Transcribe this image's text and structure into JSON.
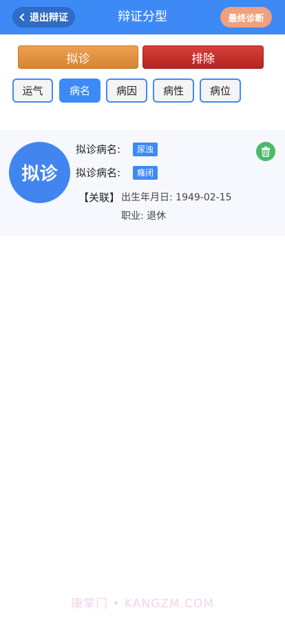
{
  "header": {
    "back_label": "退出辩证",
    "title": "辩证分型",
    "final_label": "最终诊断"
  },
  "actions": {
    "diagnose_label": "拟诊",
    "exclude_label": "排除"
  },
  "tabs": [
    {
      "label": "运气",
      "active": false
    },
    {
      "label": "病名",
      "active": true
    },
    {
      "label": "病因",
      "active": false
    },
    {
      "label": "病性",
      "active": false
    },
    {
      "label": "病位",
      "active": false
    }
  ],
  "card": {
    "avatar_text": "拟诊",
    "rows": [
      {
        "label": "拟诊病名:",
        "tag": "尿浊"
      },
      {
        "label": "拟诊病名:",
        "tag": "癃闭"
      }
    ],
    "related_label": "【关联】",
    "birth_label": "出生年月日:",
    "birth_value": "1949-02-15",
    "job_label": "职业:",
    "job_value": "退休"
  },
  "watermark": "康掌门 • KANGZM.COM",
  "colors": {
    "header_bg": "#3d8af7",
    "back_btn_bg": "#2f6cc4",
    "final_btn_bg": "#f0a07b",
    "diagnose_btn": "#e29445",
    "exclude_btn": "#c33230",
    "tab_border": "#3d8af7",
    "avatar_bg": "#4285ee",
    "delete_btn": "#4db96a",
    "card_bg": "#f6f8fd"
  }
}
